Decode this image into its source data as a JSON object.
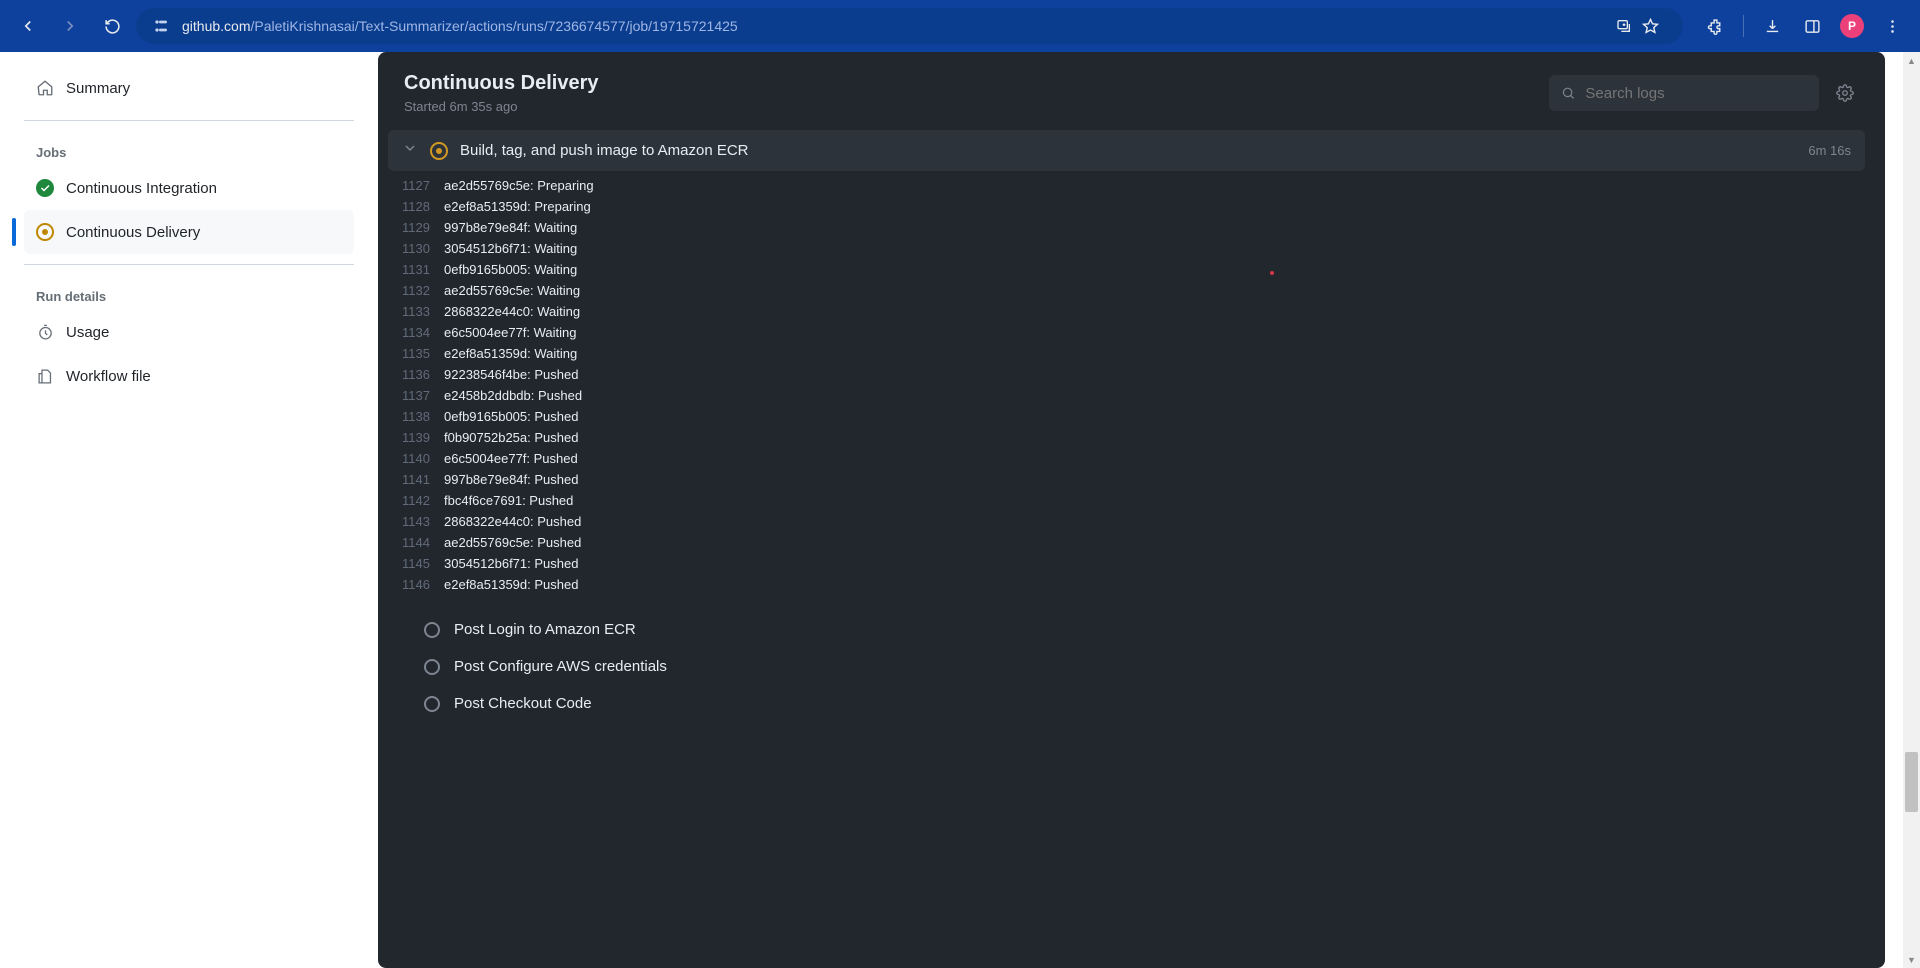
{
  "browser": {
    "url_host": "github.com",
    "url_path": "/PaletiKrishnasai/Text-Summarizer/actions/runs/7236674577/job/19715721425",
    "avatar_letter": "P"
  },
  "sidebar": {
    "summary": "Summary",
    "jobs_label": "Jobs",
    "jobs": [
      {
        "label": "Continuous Integration",
        "status": "success"
      },
      {
        "label": "Continuous Delivery",
        "status": "running"
      }
    ],
    "run_details_label": "Run details",
    "usage": "Usage",
    "workflow_file": "Workflow file"
  },
  "workflow": {
    "title": "Continuous Delivery",
    "started": "Started 6m 35s ago",
    "search_placeholder": "Search logs",
    "step_title": "Build, tag, and push image to Amazon ECR",
    "step_duration": "6m 16s",
    "post_steps": [
      "Post Login to Amazon ECR",
      "Post Configure AWS credentials",
      "Post Checkout Code"
    ],
    "log": [
      {
        "n": 1127,
        "t": "ae2d55769c5e: Preparing"
      },
      {
        "n": 1128,
        "t": "e2ef8a51359d: Preparing"
      },
      {
        "n": 1129,
        "t": "997b8e79e84f: Waiting"
      },
      {
        "n": 1130,
        "t": "3054512b6f71: Waiting"
      },
      {
        "n": 1131,
        "t": "0efb9165b005: Waiting"
      },
      {
        "n": 1132,
        "t": "ae2d55769c5e: Waiting"
      },
      {
        "n": 1133,
        "t": "2868322e44c0: Waiting"
      },
      {
        "n": 1134,
        "t": "e6c5004ee77f: Waiting"
      },
      {
        "n": 1135,
        "t": "e2ef8a51359d: Waiting"
      },
      {
        "n": 1136,
        "t": "92238546f4be: Pushed"
      },
      {
        "n": 1137,
        "t": "e2458b2ddbdb: Pushed"
      },
      {
        "n": 1138,
        "t": "0efb9165b005: Pushed"
      },
      {
        "n": 1139,
        "t": "f0b90752b25a: Pushed"
      },
      {
        "n": 1140,
        "t": "e6c5004ee77f: Pushed"
      },
      {
        "n": 1141,
        "t": "997b8e79e84f: Pushed"
      },
      {
        "n": 1142,
        "t": "fbc4f6ce7691: Pushed"
      },
      {
        "n": 1143,
        "t": "2868322e44c0: Pushed"
      },
      {
        "n": 1144,
        "t": "ae2d55769c5e: Pushed"
      },
      {
        "n": 1145,
        "t": "3054512b6f71: Pushed"
      },
      {
        "n": 1146,
        "t": "e2ef8a51359d: Pushed"
      }
    ]
  }
}
